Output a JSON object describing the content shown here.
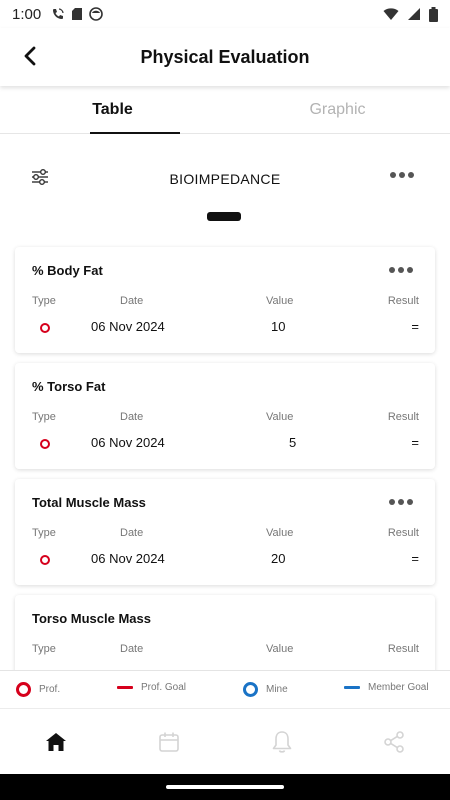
{
  "status_bar": {
    "time": "1:00",
    "icons": [
      "wifi-calling-icon",
      "sd-card-icon",
      "face-icon"
    ],
    "right_icons": [
      "wifi-icon",
      "signal-icon",
      "battery-icon"
    ]
  },
  "app_bar": {
    "title": "Physical Evaluation",
    "back_icon": "chevron-left-icon"
  },
  "tabs": [
    {
      "label": "Table",
      "active": true
    },
    {
      "label": "Graphic",
      "active": false
    }
  ],
  "section": {
    "title": "BIOIMPEDANCE",
    "filter_icon": "sliders-icon",
    "more_icon": "more-horizontal-icon"
  },
  "columns": {
    "type": "Type",
    "date": "Date",
    "value": "Value",
    "result": "Result"
  },
  "cards": [
    {
      "title": "% Body Fat",
      "date": "06 Nov 2024",
      "value": "10",
      "result": "=",
      "has_menu": true
    },
    {
      "title": "% Torso Fat",
      "date": "06 Nov 2024",
      "value": "5",
      "result": "=",
      "has_menu": false
    },
    {
      "title": "Total Muscle Mass",
      "date": "06 Nov 2024",
      "value": "20",
      "result": "=",
      "has_menu": true
    },
    {
      "title": "Torso Muscle Mass",
      "date": "",
      "value": "",
      "result": "",
      "has_menu": false
    }
  ],
  "legend": {
    "prof": "Prof.",
    "prof_goal": "Prof. Goal",
    "mine": "Mine",
    "member_goal": "Member Goal"
  },
  "colors": {
    "prof_red": "#d6001c",
    "mine_blue": "#1a73c6"
  },
  "bottom_nav": [
    {
      "icon": "home-icon",
      "active": true
    },
    {
      "icon": "calendar-icon",
      "active": false
    },
    {
      "icon": "bell-icon",
      "active": false
    },
    {
      "icon": "share-icon",
      "active": false
    }
  ]
}
